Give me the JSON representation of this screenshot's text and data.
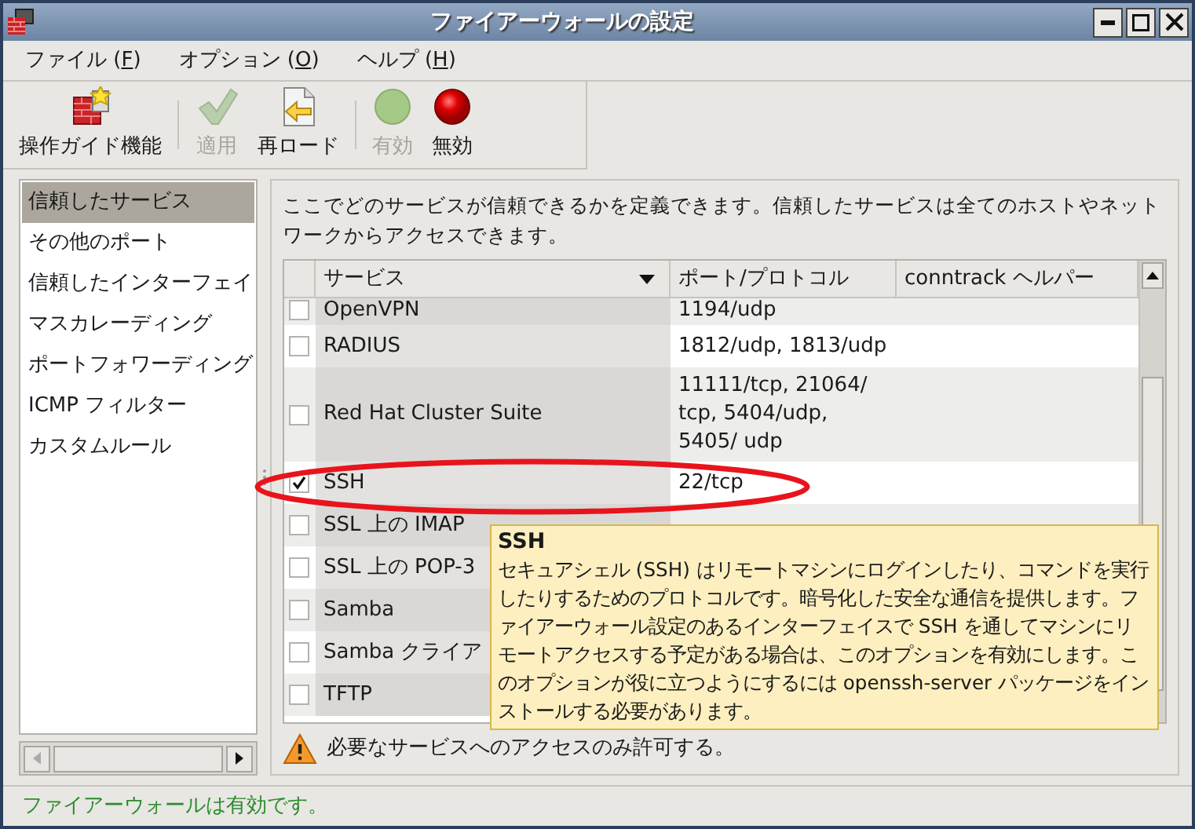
{
  "window": {
    "title": "ファイアーウォールの設定"
  },
  "menu": [
    {
      "before": "ファイル (",
      "mnemonic": "F",
      "after": ")"
    },
    {
      "before": "オプション (",
      "mnemonic": "O",
      "after": ")"
    },
    {
      "before": "ヘルプ (",
      "mnemonic": "H",
      "after": ")"
    }
  ],
  "toolbar": [
    {
      "kind": "button",
      "label": "操作ガイド機能",
      "disabled": false
    },
    {
      "kind": "separator"
    },
    {
      "kind": "button",
      "label": "適用",
      "disabled": true
    },
    {
      "kind": "button",
      "label": "再ロード",
      "disabled": false
    },
    {
      "kind": "separator"
    },
    {
      "kind": "button",
      "label": "有効",
      "disabled": true
    },
    {
      "kind": "button",
      "label": "無効",
      "disabled": false
    }
  ],
  "sidebar": {
    "items": [
      {
        "label": "信頼したサービス",
        "selected": true
      },
      {
        "label": "その他のポート",
        "selected": false
      },
      {
        "label": "信頼したインターフェイ",
        "selected": false
      },
      {
        "label": "マスカレーディング",
        "selected": false
      },
      {
        "label": "ポートフォワーディング",
        "selected": false
      },
      {
        "label": "ICMP フィルター",
        "selected": false
      },
      {
        "label": "カスタムルール",
        "selected": false
      }
    ]
  },
  "description": "ここでどのサービスが信頼できるかを定義できます。信頼したサービスは全てのホストやネットワークからアクセスできます。",
  "table": {
    "columns": [
      {
        "label": "サービス",
        "sorted": true
      },
      {
        "label": "ポート/プロトコル",
        "sorted": false
      },
      {
        "label": "conntrack ヘルパー",
        "sorted": false
      }
    ],
    "rows": [
      {
        "checked": false,
        "service": "OpenVPN",
        "port": "1194/udp"
      },
      {
        "checked": false,
        "service": "RADIUS",
        "port": "1812/udp, 1813/udp"
      },
      {
        "checked": false,
        "service": "Red Hat Cluster Suite",
        "port": "11111/tcp, 21064/ tcp, 5404/udp, 5405/ udp"
      },
      {
        "checked": true,
        "service": "SSH",
        "port": "22/tcp"
      },
      {
        "checked": false,
        "service": "SSL 上の IMAP"
      },
      {
        "checked": false,
        "service": "SSL 上の POP-3"
      },
      {
        "checked": false,
        "service": "Samba"
      },
      {
        "checked": false,
        "service": "Samba クライア"
      },
      {
        "checked": false,
        "service": "TFTP"
      }
    ]
  },
  "warning": "必要なサービスへのアクセスのみ許可する。",
  "tooltip": {
    "title": "SSH",
    "body": "セキュアシェル (SSH) はリモートマシンにログインしたり、コマンドを実行したりするためのプロトコルです。暗号化した安全な通信を提供します。ファイアーウォール設定のあるインターフェイスで SSH を通してマシンにリモートアクセスする予定がある場合は、このオプションを有効にします。このオプションが役に立つようにするには openssh-server パッケージをインストールする必要があります。"
  },
  "status_bar": "ファイアーウォールは有効です。"
}
